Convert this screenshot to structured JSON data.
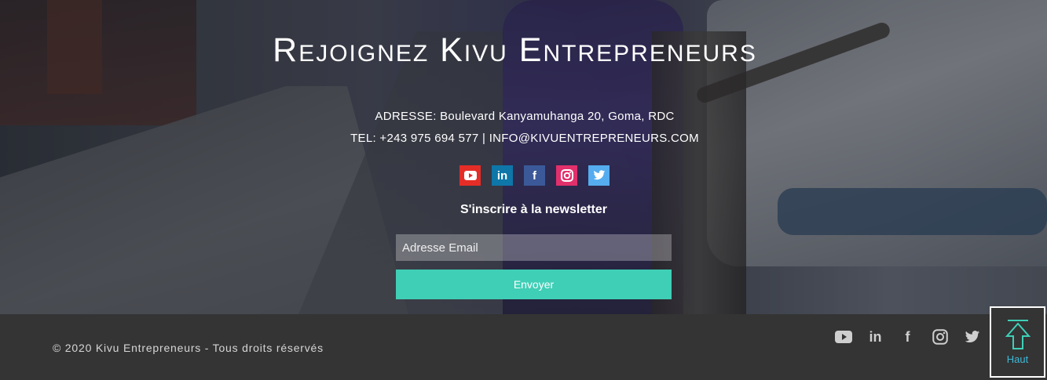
{
  "hero": {
    "title": "Rejoignez Kivu Entrepreneurs",
    "address": "ADRESSE: Boulevard Kanyamuhanga 20, Goma, RDC",
    "contact": "TEL: +243 975 694 577  |  INFO@KIVUENTREPRENEURS.COM",
    "social_icons": [
      "youtube-icon",
      "linkedin-icon",
      "facebook-icon",
      "instagram-icon",
      "twitter-icon"
    ],
    "newsletter_label": "S'inscrire à la newsletter",
    "email_placeholder": "Adresse Email",
    "send_label": "Envoyer"
  },
  "footer": {
    "copyright": "© 2020 Kivu Entrepreneurs - Tous droits réservés",
    "social_icons": [
      "youtube-icon",
      "linkedin-icon",
      "facebook-icon",
      "instagram-icon",
      "twitter-icon"
    ],
    "back_to_top_label": "Haut"
  },
  "colors": {
    "accent": "#3fcfb6",
    "footer_bg": "#343434",
    "link": "#3fb8d6"
  }
}
